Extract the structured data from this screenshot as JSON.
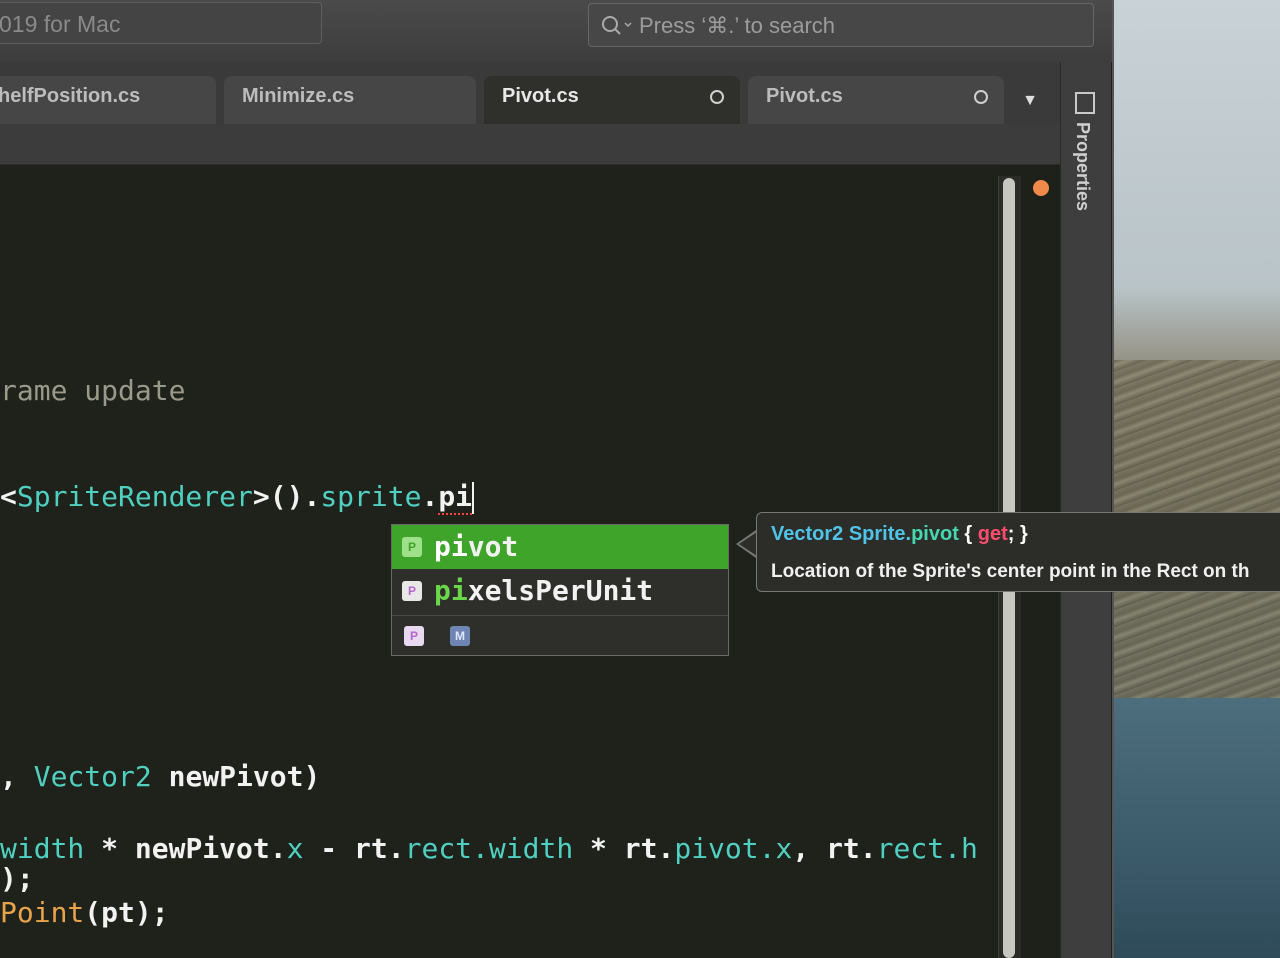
{
  "window": {
    "title": "019 for Mac",
    "search_placeholder": "Press ‘⌘.’ to search"
  },
  "tabs": [
    {
      "label": "helfPosition.cs"
    },
    {
      "label": "Minimize.cs"
    },
    {
      "label": "Pivot.cs",
      "active": true
    },
    {
      "label": "Pivot.cs"
    }
  ],
  "side_panel": {
    "label": "Properties"
  },
  "code": {
    "line_comment": "rame update",
    "line_call_prefix": "<",
    "line_call_type": "SpriteRenderer",
    "line_call_mid": ">().",
    "line_call_member": "sprite",
    "line_call_dot": ".",
    "line_call_typed": "pi",
    "line_sig_comma": ", ",
    "line_sig_type": "Vector2",
    "line_sig_rest": " newPivot)",
    "line_expr_a": "width",
    "line_expr_b": " * newPivot.",
    "line_expr_c": "x",
    "line_expr_d": " - rt.",
    "line_expr_e": "rect.width",
    "line_expr_f": " * rt.",
    "line_expr_g": "pivot.x",
    "line_expr_h": ", rt.",
    "line_expr_i": "rect.h",
    "line_close": ");",
    "line_method": "Point",
    "line_method_rest": "(pt);"
  },
  "completion": {
    "items": [
      {
        "match": "pi",
        "rest": "vot",
        "kind": "P"
      },
      {
        "match": "pi",
        "rest": "xelsPerUnit",
        "kind": "P"
      }
    ],
    "filters": [
      {
        "glyph": "P"
      },
      {
        "glyph": "M"
      }
    ]
  },
  "tooltip": {
    "type": "Vector2",
    "owner": "Sprite",
    "dot": ".",
    "member": "pivot",
    "open": " { ",
    "keyword": "get",
    "close": "; }",
    "description": "Location of the Sprite's center point in the Rect on th"
  },
  "colors": {
    "selection": "#3fa52a",
    "type": "#4fd0c0",
    "keyword": "#ff4d6d",
    "marker": "#f08a4b"
  }
}
